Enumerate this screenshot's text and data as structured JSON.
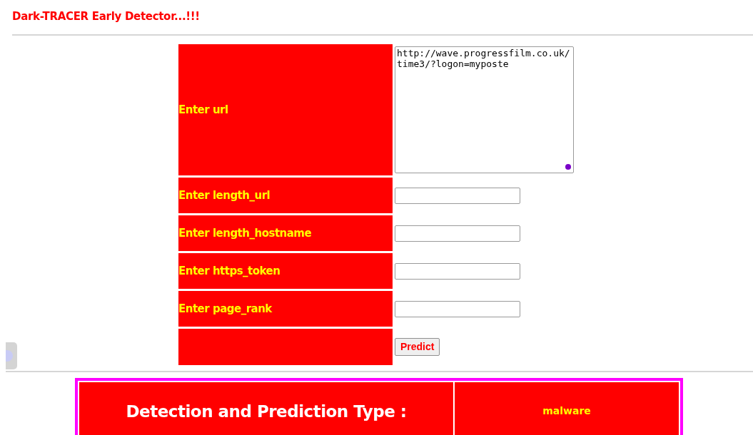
{
  "header": {
    "title": "Dark-TRACER Early Detector...!!!"
  },
  "form": {
    "fields": [
      {
        "kind": "textarea",
        "label": "Enter url",
        "value": "http://wave.progressfilm.co.uk/time3/?logon=myposte"
      },
      {
        "kind": "input",
        "label": "Enter length_url"
      },
      {
        "kind": "input",
        "label": "Enter length_hostname"
      },
      {
        "kind": "input",
        "label": "Enter https_token"
      },
      {
        "kind": "input",
        "label": "Enter page_rank"
      }
    ],
    "submit": "Predict"
  },
  "result": {
    "label": "Detection and Prediction Type :",
    "value": "malware"
  }
}
